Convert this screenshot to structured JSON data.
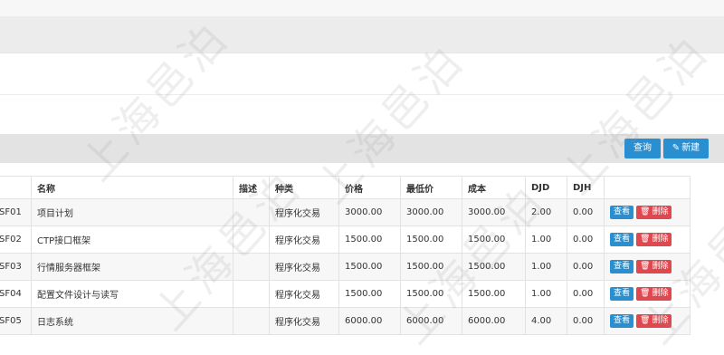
{
  "toolbar": {
    "query_label": "查询",
    "new_label": "新建"
  },
  "table": {
    "headers": [
      "",
      "名称",
      "描述",
      "种类",
      "价格",
      "最低价",
      "成本",
      "DJD",
      "DJH",
      ""
    ],
    "rows": [
      {
        "code": "SF01",
        "name": "项目计划",
        "desc": "",
        "kind": "程序化交易",
        "price": "3000.00",
        "min_price": "3000.00",
        "cost": "3000.00",
        "djd": "2.00",
        "djh": "0.00"
      },
      {
        "code": "SF02",
        "name": "CTP接口框架",
        "desc": "",
        "kind": "程序化交易",
        "price": "1500.00",
        "min_price": "1500.00",
        "cost": "1500.00",
        "djd": "1.00",
        "djh": "0.00"
      },
      {
        "code": "SF03",
        "name": "行情服务器框架",
        "desc": "",
        "kind": "程序化交易",
        "price": "1500.00",
        "min_price": "1500.00",
        "cost": "1500.00",
        "djd": "1.00",
        "djh": "0.00"
      },
      {
        "code": "SF04",
        "name": "配置文件设计与读写",
        "desc": "",
        "kind": "程序化交易",
        "price": "1500.00",
        "min_price": "1500.00",
        "cost": "1500.00",
        "djd": "1.00",
        "djh": "0.00"
      },
      {
        "code": "SF05",
        "name": "日志系统",
        "desc": "",
        "kind": "程序化交易",
        "price": "6000.00",
        "min_price": "6000.00",
        "cost": "6000.00",
        "djd": "4.00",
        "djh": "0.00"
      }
    ],
    "view_label": "查看",
    "delete_label": "删除"
  },
  "watermark": "上海邑泊"
}
